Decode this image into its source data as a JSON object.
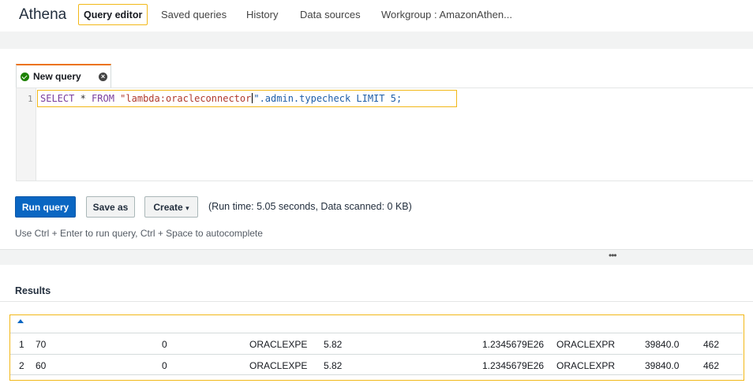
{
  "nav": {
    "brand": "Athena",
    "tabs": [
      "Query editor",
      "Saved queries",
      "History",
      "Data sources",
      "Workgroup : AmazonAthen..."
    ]
  },
  "editor": {
    "tab_label": "New query",
    "line_number": "1",
    "query": {
      "select": "SELECT",
      "star": " * ",
      "from": "FROM",
      "source": " \"lambda:oracleconnector",
      "rest": "\".admin.typecheck LIMIT 5;"
    }
  },
  "actions": {
    "run": "Run query",
    "save_as": "Save as",
    "create": "Create",
    "run_info": "(Run time: 5.05 seconds, Data scanned: 0 KB)",
    "hint": "Use Ctrl + Enter to run query, Ctrl + Space to autocomplete"
  },
  "divider_handle": "•••",
  "results": {
    "title": "Results",
    "rows": [
      [
        "1",
        "70",
        "0",
        "ORACLEXPE",
        "5.82",
        "1.2345679E26",
        "ORACLEXPR",
        "39840.0",
        "462"
      ],
      [
        "2",
        "60",
        "0",
        "ORACLEXPE",
        "5.82",
        "1.2345679E26",
        "ORACLEXPR",
        "39840.0",
        "462"
      ]
    ]
  },
  "colors": {
    "highlight": "#f2b818",
    "primary": "#0a66c2",
    "tab_accent": "#ec7211",
    "success": "#1d8102"
  }
}
